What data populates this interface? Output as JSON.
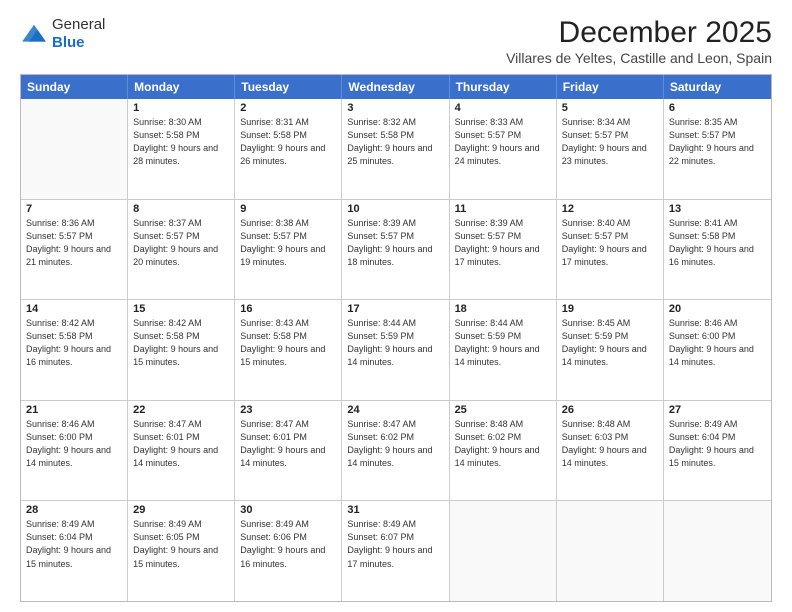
{
  "logo": {
    "general": "General",
    "blue": "Blue"
  },
  "header": {
    "title": "December 2025",
    "subtitle": "Villares de Yeltes, Castille and Leon, Spain"
  },
  "weekdays": [
    "Sunday",
    "Monday",
    "Tuesday",
    "Wednesday",
    "Thursday",
    "Friday",
    "Saturday"
  ],
  "rows": [
    [
      {
        "day": "",
        "sunrise": "",
        "sunset": "",
        "daylight": ""
      },
      {
        "day": "1",
        "sunrise": "Sunrise: 8:30 AM",
        "sunset": "Sunset: 5:58 PM",
        "daylight": "Daylight: 9 hours and 28 minutes."
      },
      {
        "day": "2",
        "sunrise": "Sunrise: 8:31 AM",
        "sunset": "Sunset: 5:58 PM",
        "daylight": "Daylight: 9 hours and 26 minutes."
      },
      {
        "day": "3",
        "sunrise": "Sunrise: 8:32 AM",
        "sunset": "Sunset: 5:58 PM",
        "daylight": "Daylight: 9 hours and 25 minutes."
      },
      {
        "day": "4",
        "sunrise": "Sunrise: 8:33 AM",
        "sunset": "Sunset: 5:57 PM",
        "daylight": "Daylight: 9 hours and 24 minutes."
      },
      {
        "day": "5",
        "sunrise": "Sunrise: 8:34 AM",
        "sunset": "Sunset: 5:57 PM",
        "daylight": "Daylight: 9 hours and 23 minutes."
      },
      {
        "day": "6",
        "sunrise": "Sunrise: 8:35 AM",
        "sunset": "Sunset: 5:57 PM",
        "daylight": "Daylight: 9 hours and 22 minutes."
      }
    ],
    [
      {
        "day": "7",
        "sunrise": "Sunrise: 8:36 AM",
        "sunset": "Sunset: 5:57 PM",
        "daylight": "Daylight: 9 hours and 21 minutes."
      },
      {
        "day": "8",
        "sunrise": "Sunrise: 8:37 AM",
        "sunset": "Sunset: 5:57 PM",
        "daylight": "Daylight: 9 hours and 20 minutes."
      },
      {
        "day": "9",
        "sunrise": "Sunrise: 8:38 AM",
        "sunset": "Sunset: 5:57 PM",
        "daylight": "Daylight: 9 hours and 19 minutes."
      },
      {
        "day": "10",
        "sunrise": "Sunrise: 8:39 AM",
        "sunset": "Sunset: 5:57 PM",
        "daylight": "Daylight: 9 hours and 18 minutes."
      },
      {
        "day": "11",
        "sunrise": "Sunrise: 8:39 AM",
        "sunset": "Sunset: 5:57 PM",
        "daylight": "Daylight: 9 hours and 17 minutes."
      },
      {
        "day": "12",
        "sunrise": "Sunrise: 8:40 AM",
        "sunset": "Sunset: 5:57 PM",
        "daylight": "Daylight: 9 hours and 17 minutes."
      },
      {
        "day": "13",
        "sunrise": "Sunrise: 8:41 AM",
        "sunset": "Sunset: 5:58 PM",
        "daylight": "Daylight: 9 hours and 16 minutes."
      }
    ],
    [
      {
        "day": "14",
        "sunrise": "Sunrise: 8:42 AM",
        "sunset": "Sunset: 5:58 PM",
        "daylight": "Daylight: 9 hours and 16 minutes."
      },
      {
        "day": "15",
        "sunrise": "Sunrise: 8:42 AM",
        "sunset": "Sunset: 5:58 PM",
        "daylight": "Daylight: 9 hours and 15 minutes."
      },
      {
        "day": "16",
        "sunrise": "Sunrise: 8:43 AM",
        "sunset": "Sunset: 5:58 PM",
        "daylight": "Daylight: 9 hours and 15 minutes."
      },
      {
        "day": "17",
        "sunrise": "Sunrise: 8:44 AM",
        "sunset": "Sunset: 5:59 PM",
        "daylight": "Daylight: 9 hours and 14 minutes."
      },
      {
        "day": "18",
        "sunrise": "Sunrise: 8:44 AM",
        "sunset": "Sunset: 5:59 PM",
        "daylight": "Daylight: 9 hours and 14 minutes."
      },
      {
        "day": "19",
        "sunrise": "Sunrise: 8:45 AM",
        "sunset": "Sunset: 5:59 PM",
        "daylight": "Daylight: 9 hours and 14 minutes."
      },
      {
        "day": "20",
        "sunrise": "Sunrise: 8:46 AM",
        "sunset": "Sunset: 6:00 PM",
        "daylight": "Daylight: 9 hours and 14 minutes."
      }
    ],
    [
      {
        "day": "21",
        "sunrise": "Sunrise: 8:46 AM",
        "sunset": "Sunset: 6:00 PM",
        "daylight": "Daylight: 9 hours and 14 minutes."
      },
      {
        "day": "22",
        "sunrise": "Sunrise: 8:47 AM",
        "sunset": "Sunset: 6:01 PM",
        "daylight": "Daylight: 9 hours and 14 minutes."
      },
      {
        "day": "23",
        "sunrise": "Sunrise: 8:47 AM",
        "sunset": "Sunset: 6:01 PM",
        "daylight": "Daylight: 9 hours and 14 minutes."
      },
      {
        "day": "24",
        "sunrise": "Sunrise: 8:47 AM",
        "sunset": "Sunset: 6:02 PM",
        "daylight": "Daylight: 9 hours and 14 minutes."
      },
      {
        "day": "25",
        "sunrise": "Sunrise: 8:48 AM",
        "sunset": "Sunset: 6:02 PM",
        "daylight": "Daylight: 9 hours and 14 minutes."
      },
      {
        "day": "26",
        "sunrise": "Sunrise: 8:48 AM",
        "sunset": "Sunset: 6:03 PM",
        "daylight": "Daylight: 9 hours and 14 minutes."
      },
      {
        "day": "27",
        "sunrise": "Sunrise: 8:49 AM",
        "sunset": "Sunset: 6:04 PM",
        "daylight": "Daylight: 9 hours and 15 minutes."
      }
    ],
    [
      {
        "day": "28",
        "sunrise": "Sunrise: 8:49 AM",
        "sunset": "Sunset: 6:04 PM",
        "daylight": "Daylight: 9 hours and 15 minutes."
      },
      {
        "day": "29",
        "sunrise": "Sunrise: 8:49 AM",
        "sunset": "Sunset: 6:05 PM",
        "daylight": "Daylight: 9 hours and 15 minutes."
      },
      {
        "day": "30",
        "sunrise": "Sunrise: 8:49 AM",
        "sunset": "Sunset: 6:06 PM",
        "daylight": "Daylight: 9 hours and 16 minutes."
      },
      {
        "day": "31",
        "sunrise": "Sunrise: 8:49 AM",
        "sunset": "Sunset: 6:07 PM",
        "daylight": "Daylight: 9 hours and 17 minutes."
      },
      {
        "day": "",
        "sunrise": "",
        "sunset": "",
        "daylight": ""
      },
      {
        "day": "",
        "sunrise": "",
        "sunset": "",
        "daylight": ""
      },
      {
        "day": "",
        "sunrise": "",
        "sunset": "",
        "daylight": ""
      }
    ]
  ]
}
